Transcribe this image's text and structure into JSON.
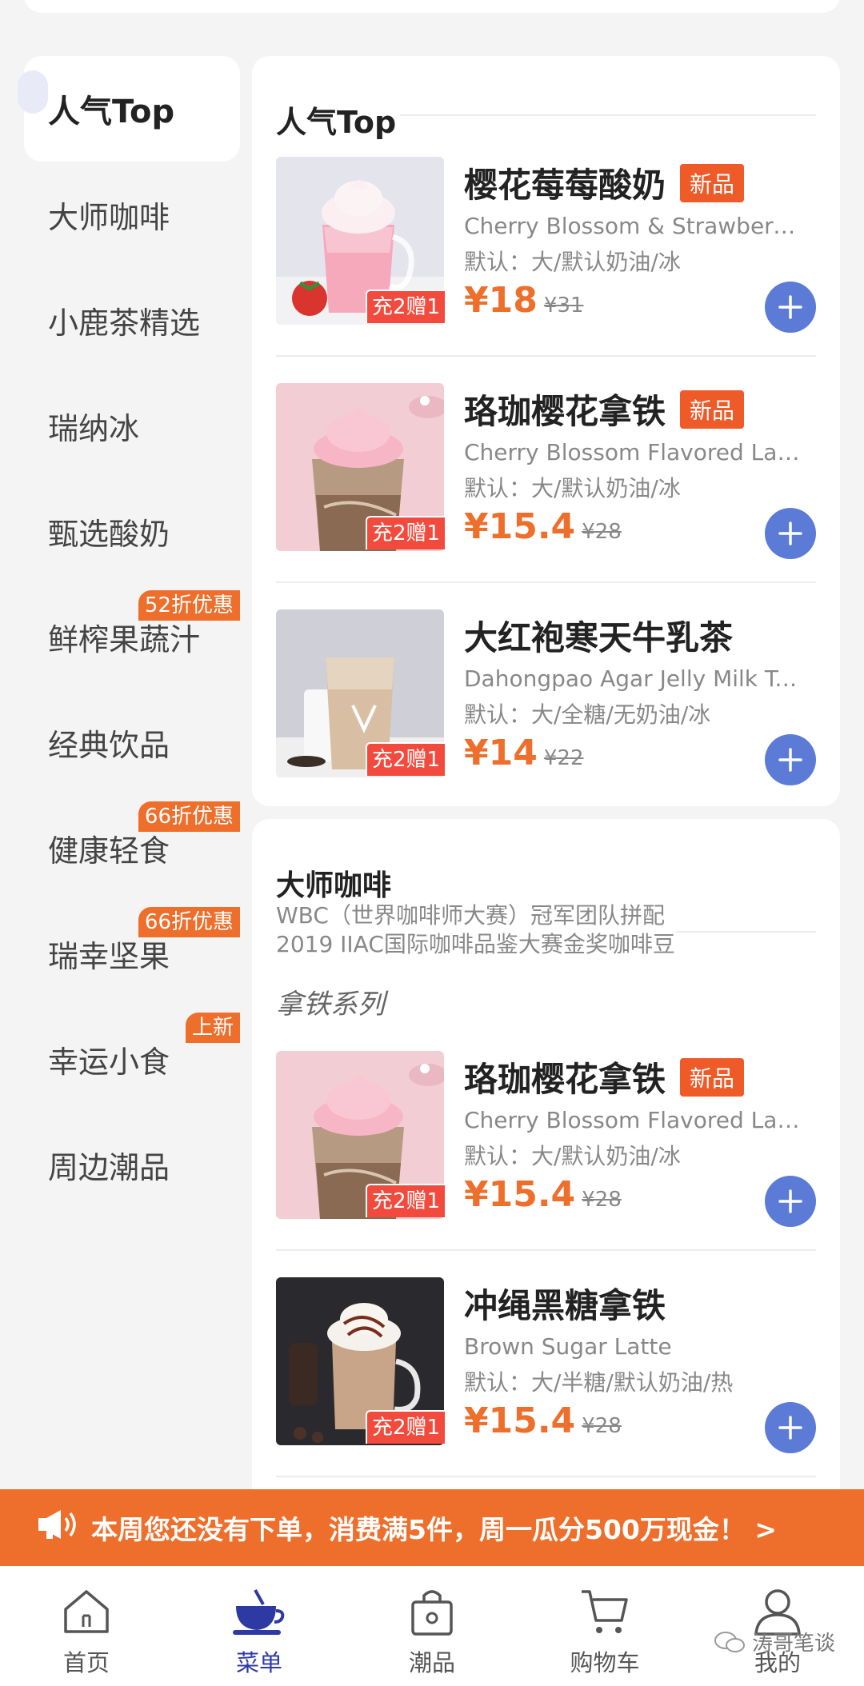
{
  "sidebar": {
    "items": [
      {
        "label": "人气Top",
        "badge": ""
      },
      {
        "label": "大师咖啡",
        "badge": ""
      },
      {
        "label": "小鹿茶精选",
        "badge": ""
      },
      {
        "label": "瑞纳冰",
        "badge": ""
      },
      {
        "label": "甄选酸奶",
        "badge": ""
      },
      {
        "label": "鲜榨果蔬汁",
        "badge": "52折优惠"
      },
      {
        "label": "经典饮品",
        "badge": ""
      },
      {
        "label": "健康轻食",
        "badge": "66折优惠"
      },
      {
        "label": "瑞幸坚果",
        "badge": "66折优惠"
      },
      {
        "label": "幸运小食",
        "badge": "上新"
      },
      {
        "label": "周边潮品",
        "badge": ""
      }
    ]
  },
  "section1": {
    "title": "人气Top",
    "products": [
      {
        "name": "樱花莓莓酸奶",
        "tag": "新品",
        "en": "Cherry Blossom & Strawberry ...",
        "spec": "默认：大/默认奶油/冰",
        "price": "¥18",
        "orig": "¥31",
        "promo": "充2赠1"
      },
      {
        "name": "珞珈樱花拿铁",
        "tag": "新品",
        "en": "Cherry Blossom Flavored Latte",
        "spec": "默认：大/默认奶油/冰",
        "price": "¥15.4",
        "orig": "¥28",
        "promo": "充2赠1"
      },
      {
        "name": "大红袍寒天牛乳茶",
        "tag": "",
        "en": "Dahongpao Agar Jelly Milk Tea",
        "spec": "默认：大/全糖/无奶油/冰",
        "price": "¥14",
        "orig": "¥22",
        "promo": "充2赠1"
      }
    ]
  },
  "section2": {
    "title": "大师咖啡",
    "desc1": "WBC（世界咖啡师大赛）冠军团队拼配",
    "desc2": "2019 IIAC国际咖啡品鉴大赛金奖咖啡豆",
    "series": "拿铁系列",
    "products": [
      {
        "name": "珞珈樱花拿铁",
        "tag": "新品",
        "en": "Cherry Blossom Flavored Latte",
        "spec": "默认：大/默认奶油/冰",
        "price": "¥15.4",
        "orig": "¥28",
        "promo": "充2赠1"
      },
      {
        "name": "冲绳黑糖拿铁",
        "tag": "",
        "en": "Brown Sugar Latte",
        "spec": "默认：大/半糖/默认奶油/热",
        "price": "¥15.4",
        "orig": "¥28",
        "promo": "充2赠1"
      }
    ]
  },
  "banner": {
    "text": "本周您还没有下单，消费满5件，周一瓜分500万现金！ >"
  },
  "nav": {
    "items": [
      {
        "label": "首页",
        "icon": "home-icon"
      },
      {
        "label": "菜单",
        "icon": "coffee-cup-icon"
      },
      {
        "label": "潮品",
        "icon": "shopping-bag-icon"
      },
      {
        "label": "购物车",
        "icon": "cart-icon"
      },
      {
        "label": "我的",
        "icon": "profile-icon"
      }
    ]
  },
  "watermark": "涛哥笔谈",
  "colors": {
    "accent": "#ee6e2b",
    "blue": "#5b7bd6",
    "navActive": "#2e3aa3",
    "promo": "#f24b3d"
  }
}
